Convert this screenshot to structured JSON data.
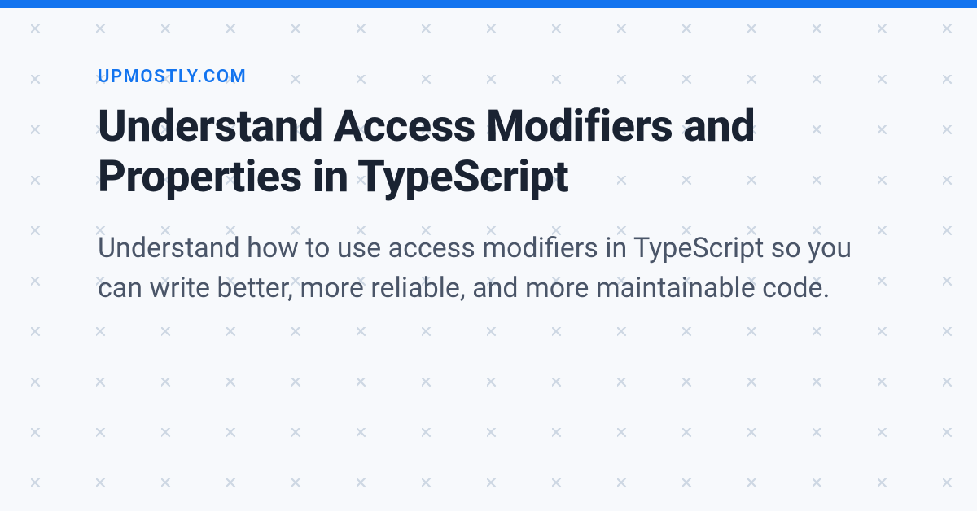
{
  "site_name": "UPMOSTLY.COM",
  "title": "Understand Access Modifiers and Properties in TypeScript",
  "description": "Understand how to use access modifiers in TypeScript so you can write better, more reliable, and more maintainable code.",
  "colors": {
    "accent": "#1374ef",
    "heading": "#1a2332",
    "body": "#4a5568",
    "background": "#f7f9fc",
    "pattern": "#cdd7e3"
  }
}
